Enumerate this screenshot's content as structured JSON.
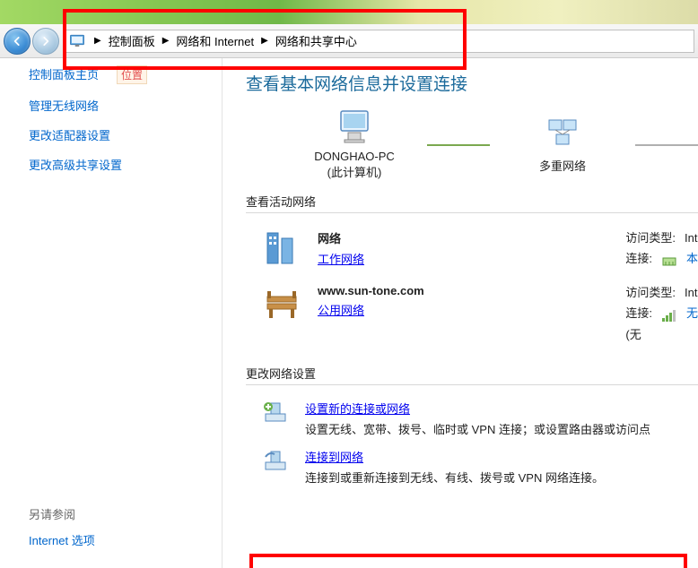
{
  "breadcrumb": {
    "items": [
      "控制面板",
      "网络和 Internet",
      "网络和共享中心"
    ]
  },
  "sidebar": {
    "items": [
      {
        "label": "控制面板主页",
        "hasLoc": true,
        "locLabel": "位置"
      },
      {
        "label": "管理无线网络"
      },
      {
        "label": "更改适配器设置"
      },
      {
        "label": "更改高级共享设置"
      }
    ],
    "seeAlso": {
      "heading": "另请参阅",
      "items": [
        "Internet 选项"
      ]
    }
  },
  "main": {
    "heading": "查看基本网络信息并设置连接",
    "map": {
      "localName": "DONGHAO-PC",
      "localSub": "(此计算机)",
      "midName": "多重网络"
    },
    "activeHead": "查看活动网络",
    "networks": [
      {
        "name": "网络",
        "type": "工作网络",
        "accessLabel": "访问类型:",
        "accessValue": "Int",
        "connLabel": "连接:",
        "connValue": "本"
      },
      {
        "name": "www.sun-tone.com",
        "type": "公用网络",
        "accessLabel": "访问类型:",
        "accessValue": "Int",
        "connLabel": "连接:",
        "connValue": "无",
        "extra": "(无"
      }
    ],
    "changeHead": "更改网络设置",
    "settings": [
      {
        "title": "设置新的连接或网络",
        "desc": "设置无线、宽带、拨号、临时或 VPN 连接；或设置路由器或访问点"
      },
      {
        "title": "连接到网络",
        "desc": "连接到或重新连接到无线、有线、拨号或 VPN 网络连接。"
      }
    ]
  }
}
